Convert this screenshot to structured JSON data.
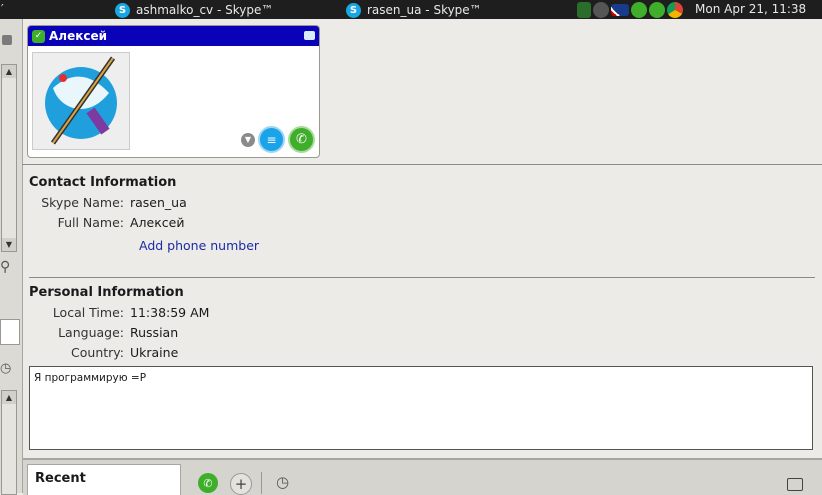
{
  "topbar": {
    "lead": "′",
    "tasks": [
      {
        "label": "ashmalko_cv - Skype™"
      },
      {
        "label": "rasen_ua - Skype™"
      }
    ],
    "clock": "Mon Apr 21, 11:38"
  },
  "card": {
    "name": "Алексей",
    "status": "online"
  },
  "contact_info": {
    "title": "Contact Information",
    "skype_name_label": "Skype Name:",
    "skype_name": "rasen_ua",
    "full_name_label": "Full Name:",
    "full_name": "Алексей",
    "add_phone": "Add phone number"
  },
  "personal_info": {
    "title": "Personal Information",
    "local_time_label": "Local Time:",
    "local_time": "11:38:59 AM",
    "language_label": "Language:",
    "language": "Russian",
    "country_label": "Country:",
    "country": "Ukraine"
  },
  "mood_message": "Я программирую =P",
  "bottom": {
    "recent_tab": "Recent"
  },
  "colors": {
    "card_header": "#0a02b8",
    "link": "#1c2aa6",
    "call_green": "#3fae2a",
    "chat_blue": "#1aa3e8"
  }
}
